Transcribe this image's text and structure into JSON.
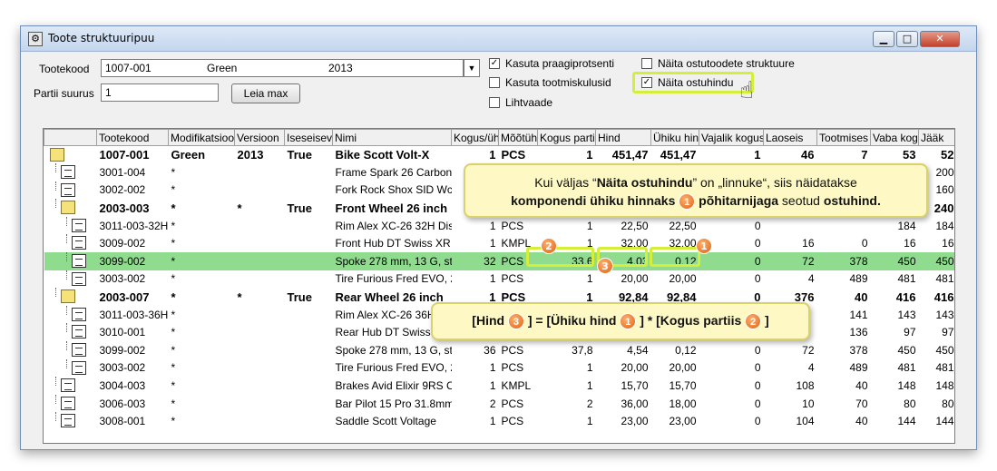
{
  "window": {
    "title": "Toote struktuuripuu"
  },
  "form": {
    "tootekood_label": "Tootekood",
    "tootekood_value": "1007-001",
    "modification": "Green",
    "version": "2013",
    "partii_label": "Partii suurus",
    "partii_value": "1",
    "leia_button": "Leia max",
    "checkboxes": [
      {
        "label": "Kasuta praagiprotsenti",
        "checked": "✓"
      },
      {
        "label": "Kasuta tootmiskulusid",
        "checked": ""
      },
      {
        "label": "Lihtvaade",
        "checked": ""
      },
      {
        "label": "Näita ostutoodete struktuure",
        "checked": ""
      },
      {
        "label": "Näita ostuhindu",
        "checked": "✓"
      }
    ]
  },
  "columns": [
    "Tootekood",
    "Modifikatsioo",
    "Versioon",
    "Iseseisev",
    "Nimi",
    "Kogus/üh",
    "Mõõtüh",
    "Kogus partiis",
    "Hind",
    "Ühiku hin",
    "Vajalik kogus",
    "Laoseis",
    "Tootmises",
    "Vaba kog",
    "Jääk"
  ],
  "rows": [
    {
      "code": "1007-001",
      "mod": "Green",
      "ver": "2013",
      "ind": "True",
      "name": "Bike Scott Volt-X",
      "qty": "1",
      "unit": "PCS",
      "batch": "1",
      "price": "451,47",
      "unit_price": "451,47",
      "need": "1",
      "stock": "46",
      "prod": "7",
      "free": "53",
      "rest": "52"
    },
    {
      "code": "3001-004",
      "mod": "*",
      "ver": "",
      "ind": "",
      "name": "Frame Spark 26 Carbon,",
      "qty": "",
      "unit": "",
      "batch": "",
      "price": "",
      "unit_price": "",
      "need": "",
      "stock": "",
      "prod": "",
      "free": "",
      "rest": "200"
    },
    {
      "code": "3002-002",
      "mod": "*",
      "ver": "",
      "ind": "",
      "name": "Fork Rock Shox SID Wc",
      "qty": "",
      "unit": "",
      "batch": "",
      "price": "",
      "unit_price": "",
      "need": "",
      "stock": "",
      "prod": "",
      "free": "",
      "rest": "160"
    },
    {
      "code": "2003-003",
      "mod": "*",
      "ver": "*",
      "ind": "True",
      "name": "Front Wheel 26 inch",
      "qty": "",
      "unit": "",
      "batch": "",
      "price": "",
      "unit_price": "",
      "need": "",
      "stock": "",
      "prod": "",
      "free": "",
      "rest": "240"
    },
    {
      "code": "3011-003-32H",
      "mod": "*",
      "ver": "",
      "ind": "",
      "name": "Rim Alex XC-26 32H Disc",
      "qty": "1",
      "unit": "PCS",
      "batch": "1",
      "price": "22,50",
      "unit_price": "22,50",
      "need": "0",
      "stock": "",
      "prod": "",
      "free": "184",
      "rest": "184"
    },
    {
      "code": "3009-002",
      "mod": "*",
      "ver": "",
      "ind": "",
      "name": "Front Hub DT Swiss XR",
      "qty": "1",
      "unit": "KMPL",
      "batch": "1",
      "price": "32,00",
      "unit_price": "32,00",
      "need": "0",
      "stock": "16",
      "prod": "0",
      "free": "16",
      "rest": "16"
    },
    {
      "code": "3099-002",
      "mod": "*",
      "ver": "",
      "ind": "",
      "name": "Spoke 278 mm, 13 G, sta",
      "qty": "32",
      "unit": "PCS",
      "batch": "33,6",
      "price": "4,03",
      "unit_price": "0,12",
      "need": "0",
      "stock": "72",
      "prod": "378",
      "free": "450",
      "rest": "450"
    },
    {
      "code": "3003-002",
      "mod": "*",
      "ver": "",
      "ind": "",
      "name": "Tire Furious Fred EVO, 2",
      "qty": "1",
      "unit": "PCS",
      "batch": "1",
      "price": "20,00",
      "unit_price": "20,00",
      "need": "0",
      "stock": "4",
      "prod": "489",
      "free": "481",
      "rest": "481"
    },
    {
      "code": "2003-007",
      "mod": "*",
      "ver": "*",
      "ind": "True",
      "name": "Rear Wheel 26 inch",
      "qty": "1",
      "unit": "PCS",
      "batch": "1",
      "price": "92,84",
      "unit_price": "92,84",
      "need": "0",
      "stock": "376",
      "prod": "40",
      "free": "416",
      "rest": "416"
    },
    {
      "code": "3011-003-36H",
      "mod": "*",
      "ver": "",
      "ind": "",
      "name": "Rim Alex XC-26 36H",
      "qty": "",
      "unit": "",
      "batch": "",
      "price": "",
      "unit_price": "",
      "need": "",
      "stock": "",
      "prod": "141",
      "free": "143",
      "rest": "143"
    },
    {
      "code": "3010-001",
      "mod": "*",
      "ver": "",
      "ind": "",
      "name": "Rear Hub DT Swiss",
      "qty": "",
      "unit": "",
      "batch": "",
      "price": "",
      "unit_price": "",
      "need": "",
      "stock": "",
      "prod": "136",
      "free": "97",
      "rest": "97"
    },
    {
      "code": "3099-002",
      "mod": "*",
      "ver": "",
      "ind": "",
      "name": "Spoke 278 mm, 13 G, sta",
      "qty": "36",
      "unit": "PCS",
      "batch": "37,8",
      "price": "4,54",
      "unit_price": "0,12",
      "need": "0",
      "stock": "72",
      "prod": "378",
      "free": "450",
      "rest": "450"
    },
    {
      "code": "3003-002",
      "mod": "*",
      "ver": "",
      "ind": "",
      "name": "Tire Furious Fred EVO, 2",
      "qty": "1",
      "unit": "PCS",
      "batch": "1",
      "price": "20,00",
      "unit_price": "20,00",
      "need": "0",
      "stock": "4",
      "prod": "489",
      "free": "481",
      "rest": "481"
    },
    {
      "code": "3004-003",
      "mod": "*",
      "ver": "",
      "ind": "",
      "name": "Brakes Avid Elixir 9RS C/",
      "qty": "1",
      "unit": "KMPL",
      "batch": "1",
      "price": "15,70",
      "unit_price": "15,70",
      "need": "0",
      "stock": "108",
      "prod": "40",
      "free": "148",
      "rest": "148"
    },
    {
      "code": "3006-003",
      "mod": "*",
      "ver": "",
      "ind": "",
      "name": "Bar Pilot 15 Pro 31.8mm",
      "qty": "2",
      "unit": "PCS",
      "batch": "2",
      "price": "36,00",
      "unit_price": "18,00",
      "need": "0",
      "stock": "10",
      "prod": "70",
      "free": "80",
      "rest": "80"
    },
    {
      "code": "3008-001",
      "mod": "*",
      "ver": "",
      "ind": "",
      "name": "Saddle Scott Voltage",
      "qty": "1",
      "unit": "PCS",
      "batch": "1",
      "price": "23,00",
      "unit_price": "23,00",
      "need": "0",
      "stock": "104",
      "prod": "40",
      "free": "144",
      "rest": "144"
    }
  ],
  "callout1": {
    "pre": "Kui väljas “",
    "bold1": "Näita ostuhindu",
    "mid": "” on „linnuke“, siis näidatakse",
    "bold2": "komponendi ühiku hinnaks",
    "badge": "1",
    "bold3": "põhitarnijaga",
    "mid2": " seotud ",
    "bold4": "ostuhind."
  },
  "callout2": {
    "open": "[Hind ",
    "b3": "3",
    "eq": " ] = [Ühiku hind ",
    "b1": "1",
    "mul": " ] * [Kogus partiis ",
    "b2": "2",
    "close": " ]"
  },
  "badges": {
    "one": "1",
    "two": "2",
    "three": "3"
  },
  "colors": {
    "selected_row": "#8fdc8f",
    "callout_bg": "#fdf8c4",
    "highlight": "#d4ee3a",
    "badge": "#e06010"
  }
}
